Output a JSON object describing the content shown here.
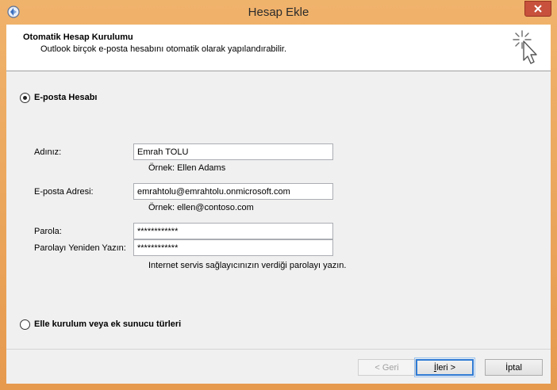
{
  "window": {
    "title": "Hesap Ekle"
  },
  "header": {
    "title": "Otomatik Hesap Kurulumu",
    "subtitle": "Outlook birçok e-posta hesabını otomatik olarak yapılandırabilir."
  },
  "options": {
    "email_account": {
      "label": "E-posta Hesabı",
      "selected": true
    },
    "manual": {
      "label": "Elle kurulum veya ek sunucu türleri",
      "selected": false
    }
  },
  "form": {
    "name": {
      "label": "Adınız:",
      "value": "Emrah TOLU",
      "hint": "Örnek: Ellen Adams"
    },
    "email": {
      "label": "E-posta Adresi:",
      "value": "emrahtolu@emrahtolu.onmicrosoft.com",
      "hint": "Örnek: ellen@contoso.com"
    },
    "password": {
      "label": "Parola:",
      "value": "************"
    },
    "password_confirm": {
      "label": "Parolayı Yeniden Yazın:",
      "value": "************"
    },
    "password_hint": "Internet servis sağlayıcınızın verdiği parolayı yazın."
  },
  "buttons": {
    "back": "< Geri",
    "next_prefix": "İ",
    "next_rest": "leri >",
    "cancel": "İptal"
  },
  "icons": {
    "app": "outlook-icon",
    "close": "close-icon",
    "wizard": "cursor-sparkle-icon"
  },
  "colors": {
    "accent": "#2f7bd5",
    "close": "#c7513c",
    "frame": "#e8a15a"
  }
}
